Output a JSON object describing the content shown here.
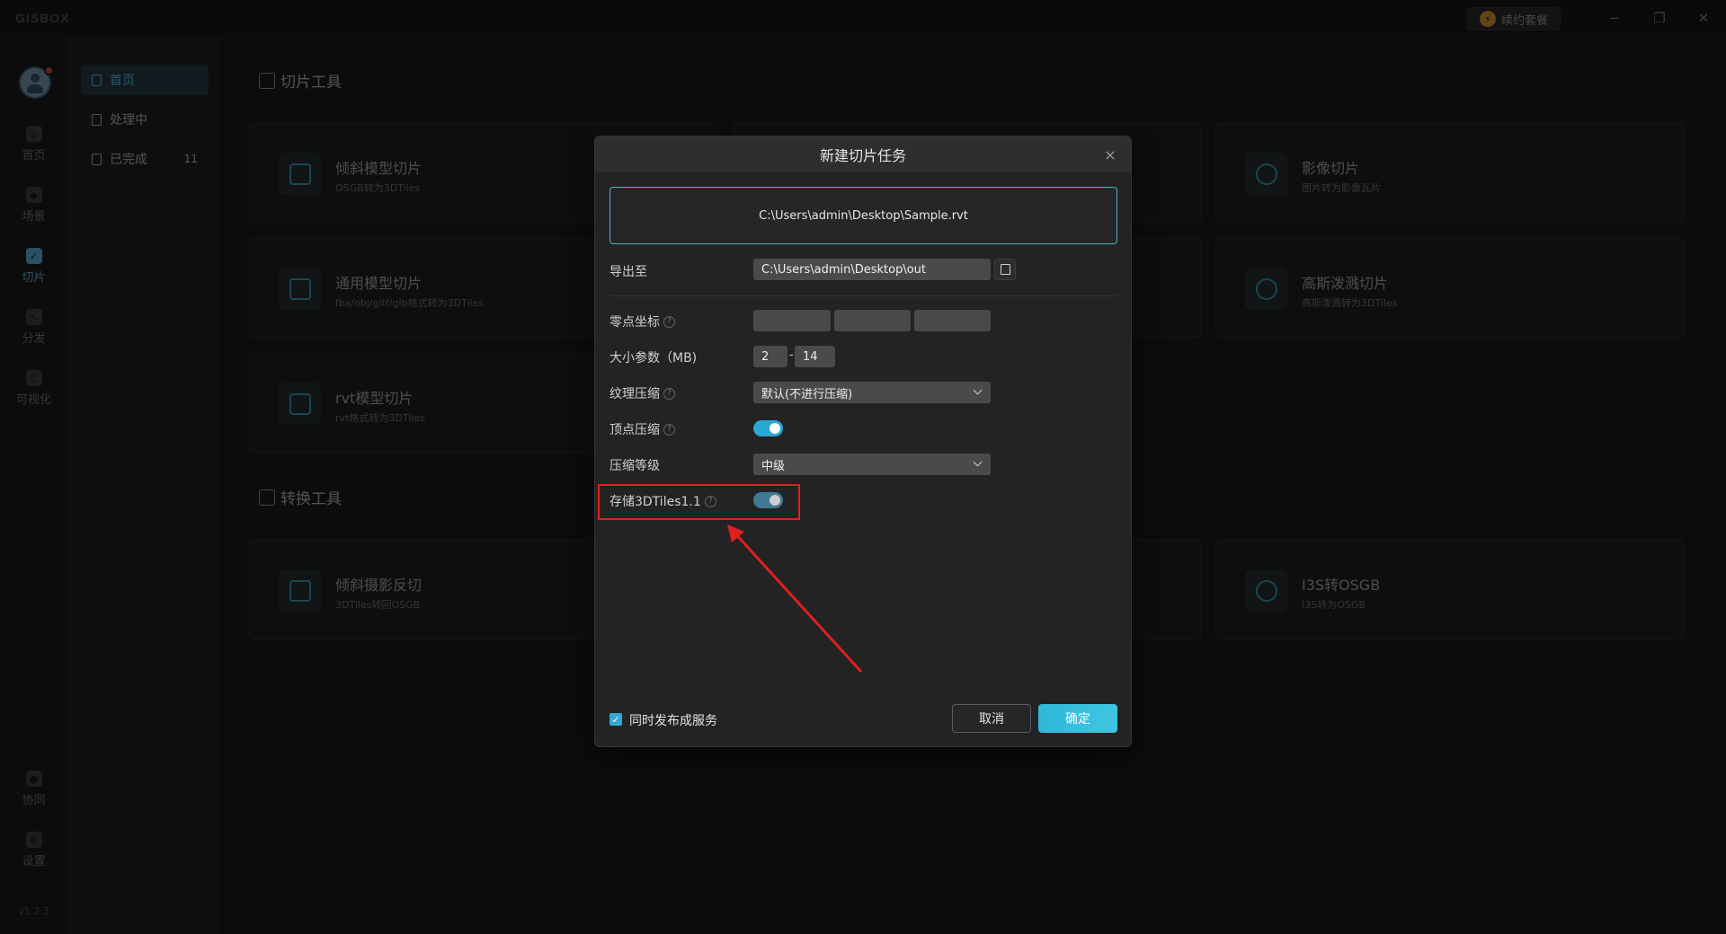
{
  "app": {
    "logo": "GISBOX",
    "renew_label": "续约套餐",
    "version": "v1.2.3"
  },
  "window_controls": {
    "minimize": "−",
    "restore": "❐",
    "close": "✕"
  },
  "rail": {
    "items": [
      {
        "label": "首页",
        "icon": "home-icon"
      },
      {
        "label": "场景",
        "icon": "cube-icon"
      },
      {
        "label": "切片",
        "icon": "slice-icon",
        "active": true
      },
      {
        "label": "分发",
        "icon": "distribute-icon"
      },
      {
        "label": "可视化",
        "icon": "visual-icon"
      }
    ],
    "bottom": [
      {
        "label": "协同",
        "icon": "lock-icon"
      },
      {
        "label": "设置",
        "icon": "gear-icon"
      }
    ]
  },
  "subnav": {
    "items": [
      {
        "label": "首页",
        "active": true
      },
      {
        "label": "处理中"
      },
      {
        "label": "已完成",
        "count": "11"
      }
    ]
  },
  "sections": {
    "slice_tools": "切片工具",
    "convert_tools": "转换工具"
  },
  "cards": [
    {
      "title": "倾斜模型切片",
      "subtitle": "OSGB转为3DTiles",
      "icon": "drone-icon"
    },
    {
      "title": "影像切片",
      "subtitle": "图片转为影像瓦片",
      "icon": "cloud-icon"
    },
    {
      "title": "通用模型切片",
      "subtitle": "fbx/obj/gltf/glb格式转为3DTiles",
      "icon": "box-icon"
    },
    {
      "title": "高斯泼溅切片",
      "subtitle": "高斯泼溅转为3DTiles",
      "icon": "splat-icon"
    },
    {
      "title": "rvt模型切片",
      "subtitle": "rvt格式转为3DTiles",
      "icon": "box-icon"
    },
    {
      "title": "倾斜摄影反切",
      "subtitle": "3DTiles转回OSGB",
      "icon": "reverse-icon"
    },
    {
      "title": "I3S转OSGB",
      "subtitle": "I3S转为OSGB",
      "icon": "i3s-icon"
    }
  ],
  "modal": {
    "title": "新建切片任务",
    "close": "×",
    "file_path": "C:\\Users\\admin\\Desktop\\Sample.rvt",
    "export_label": "导出至",
    "export_path": "C:\\Users\\admin\\Desktop\\out",
    "origin_label": "零点坐标",
    "size_label": "大小参数（MB)",
    "size_min": "2",
    "size_max": "14",
    "size_dash": "-",
    "texture_label": "纹理压缩",
    "texture_value": "默认(不进行压缩)",
    "vertex_label": "顶点压缩",
    "vertex_on": true,
    "level_label": "压缩等级",
    "level_value": "中级",
    "store_label": "存储3DTiles1.1",
    "store_on": true,
    "publish_label": "同时发布成服务",
    "publish_checked": true,
    "cancel_label": "取消",
    "ok_label": "确定",
    "help_mark": "?"
  },
  "annotation": {
    "highlight_color": "#e01f1f"
  }
}
